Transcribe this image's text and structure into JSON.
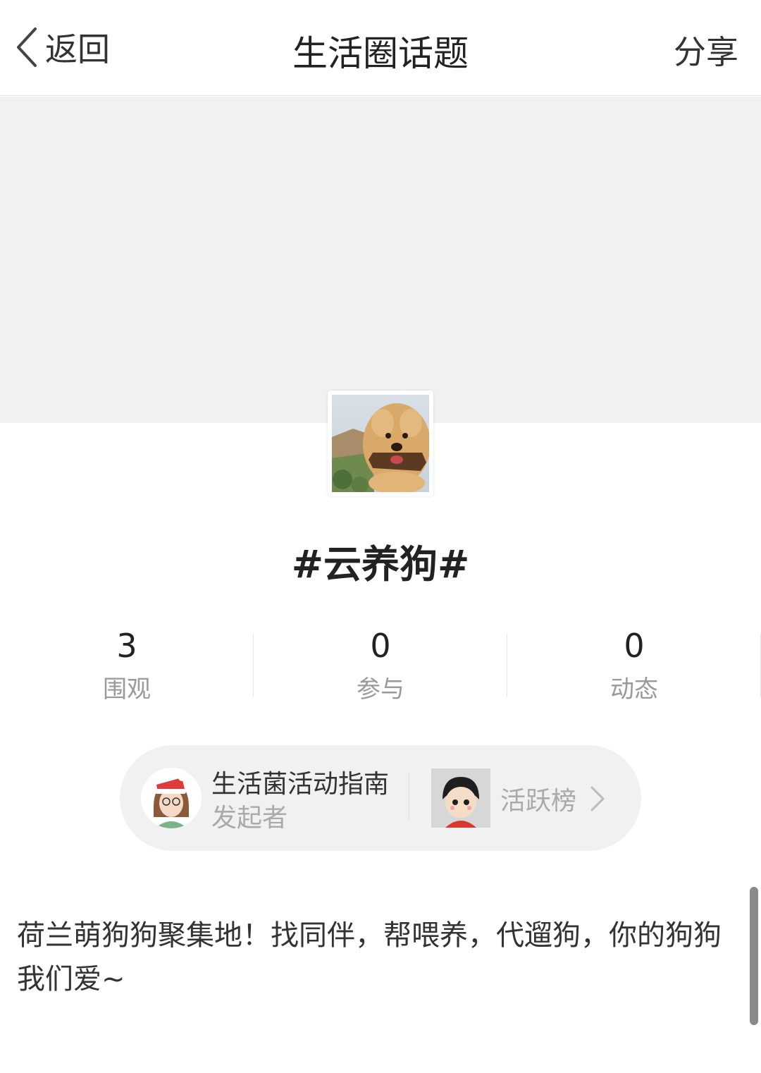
{
  "nav": {
    "back_label": "返回",
    "title": "生活圈话题",
    "share_label": "分享"
  },
  "topic": {
    "title": "#云养狗#"
  },
  "stats": [
    {
      "value": "3",
      "label": "围观"
    },
    {
      "value": "0",
      "label": "参与"
    },
    {
      "value": "0",
      "label": "动态"
    }
  ],
  "organizer": {
    "name": "生活菌活动指南",
    "role": "发起者"
  },
  "ranking": {
    "label": "活跃榜"
  },
  "description": "荷兰萌狗狗聚集地！找同伴，帮喂养，代遛狗，你的狗狗我们爱~",
  "colors": {
    "cover_bg": "#f1f1f1",
    "pill_bg": "#f1f1f1",
    "muted_text": "#9a9a9a"
  },
  "icons": {
    "back": "chevron-left-icon",
    "ranking_arrow": "chevron-right-icon"
  }
}
